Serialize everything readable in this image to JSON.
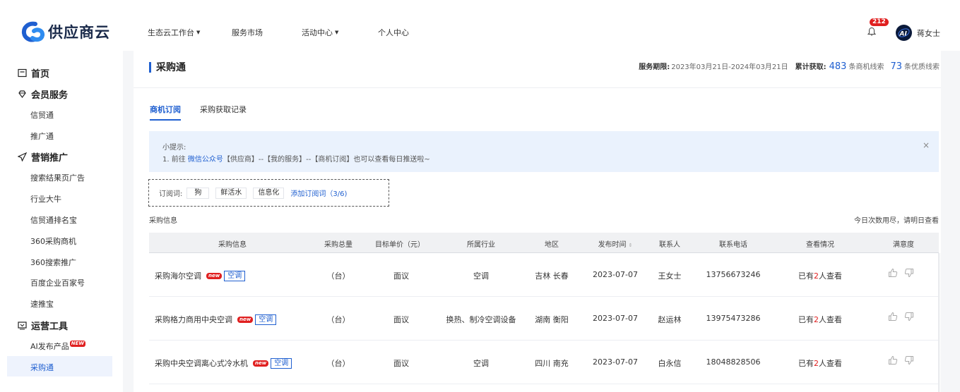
{
  "brand": {
    "name": "供应商云"
  },
  "nav": [
    {
      "label": "生态云工作台",
      "dropdown": true
    },
    {
      "label": "服务市场",
      "dropdown": false
    },
    {
      "label": "活动中心",
      "dropdown": true
    },
    {
      "label": "个人中心",
      "dropdown": false
    }
  ],
  "header": {
    "notification_count": "212",
    "username": "蒋女士",
    "avatar_text": "AI"
  },
  "sidebar": {
    "home": "首页",
    "member_services": "会员服务",
    "marketing": "营销推广",
    "operations": "运营工具",
    "items": {
      "xinmaotong": "信贸通",
      "tuiguangtong": "推广通",
      "search_ads": "搜索结果页广告",
      "industry_leader": "行业大牛",
      "xinmao_rank": "信贸通排名宝",
      "so360_purchase": "360采购商机",
      "so360_search": "360搜索推广",
      "baidu_baijia": "百度企业百家号",
      "sutuibao": "速推宝",
      "ai_publish": "AI发布产品",
      "ai_publish_badge": "NEW",
      "caigoutong": "采购通"
    }
  },
  "page": {
    "title": "采购通",
    "service_period_label": "服务期限:",
    "service_period": "2023年03月21日-2024年03月21日",
    "accumulated_label": "累计获取:",
    "leads_count": "483",
    "leads_unit": "条商机线索",
    "quality_count": "73",
    "quality_unit": "条优质线索"
  },
  "tabs": [
    {
      "label": "商机订阅",
      "active": true
    },
    {
      "label": "采购获取记录",
      "active": false
    }
  ],
  "tip": {
    "title": "小提示:",
    "line_prefix": "1. 前往 ",
    "link": "微信公众号",
    "line_suffix": "【供应商】--【我的服务】--【商机订阅】也可以查看每日推送啦~",
    "close": "×"
  },
  "subscribe": {
    "label": "订阅词:",
    "keywords": [
      "狗",
      "鲜活水",
      "信息化"
    ],
    "add_label": "添加订阅词（3/6)"
  },
  "section": {
    "label": "采购信息",
    "right_note": "今日次数用尽，请明日查看"
  },
  "table": {
    "columns": [
      "采购信息",
      "采购总量",
      "目标单价（元）",
      "所属行业",
      "地区",
      "发布时间",
      "联系人",
      "联系电话",
      "查看情况",
      "满意度"
    ],
    "new_badge": "new",
    "rows": [
      {
        "title": "采购海尔空调",
        "tag": "空调",
        "qty": "（台）",
        "price": "面议",
        "industry": "空调",
        "region": "吉林 长春",
        "date": "2023-07-07",
        "contact": "王女士",
        "phone": "13756673246",
        "view_prefix": "已有",
        "view_num": "2",
        "view_suffix": "人查看"
      },
      {
        "title": "采购格力商用中央空调",
        "tag": "空调",
        "qty": "（台）",
        "price": "面议",
        "industry": "换热、制冷空调设备",
        "region": "湖南 衡阳",
        "date": "2023-07-07",
        "contact": "赵运林",
        "phone": "13975473286",
        "view_prefix": "已有",
        "view_num": "2",
        "view_suffix": "人查看"
      },
      {
        "title": "采购中央空调离心式冷水机",
        "tag": "空调",
        "qty": "（台）",
        "price": "面议",
        "industry": "空调",
        "region": "四川 南充",
        "date": "2023-07-07",
        "contact": "白永信",
        "phone": "18048828506",
        "view_prefix": "已有",
        "view_num": "2",
        "view_suffix": "人查看"
      }
    ]
  },
  "colors": {
    "accent": "#1f5fd0",
    "badge_red": "#e02020",
    "tip_bg": "#eaf2fd"
  }
}
